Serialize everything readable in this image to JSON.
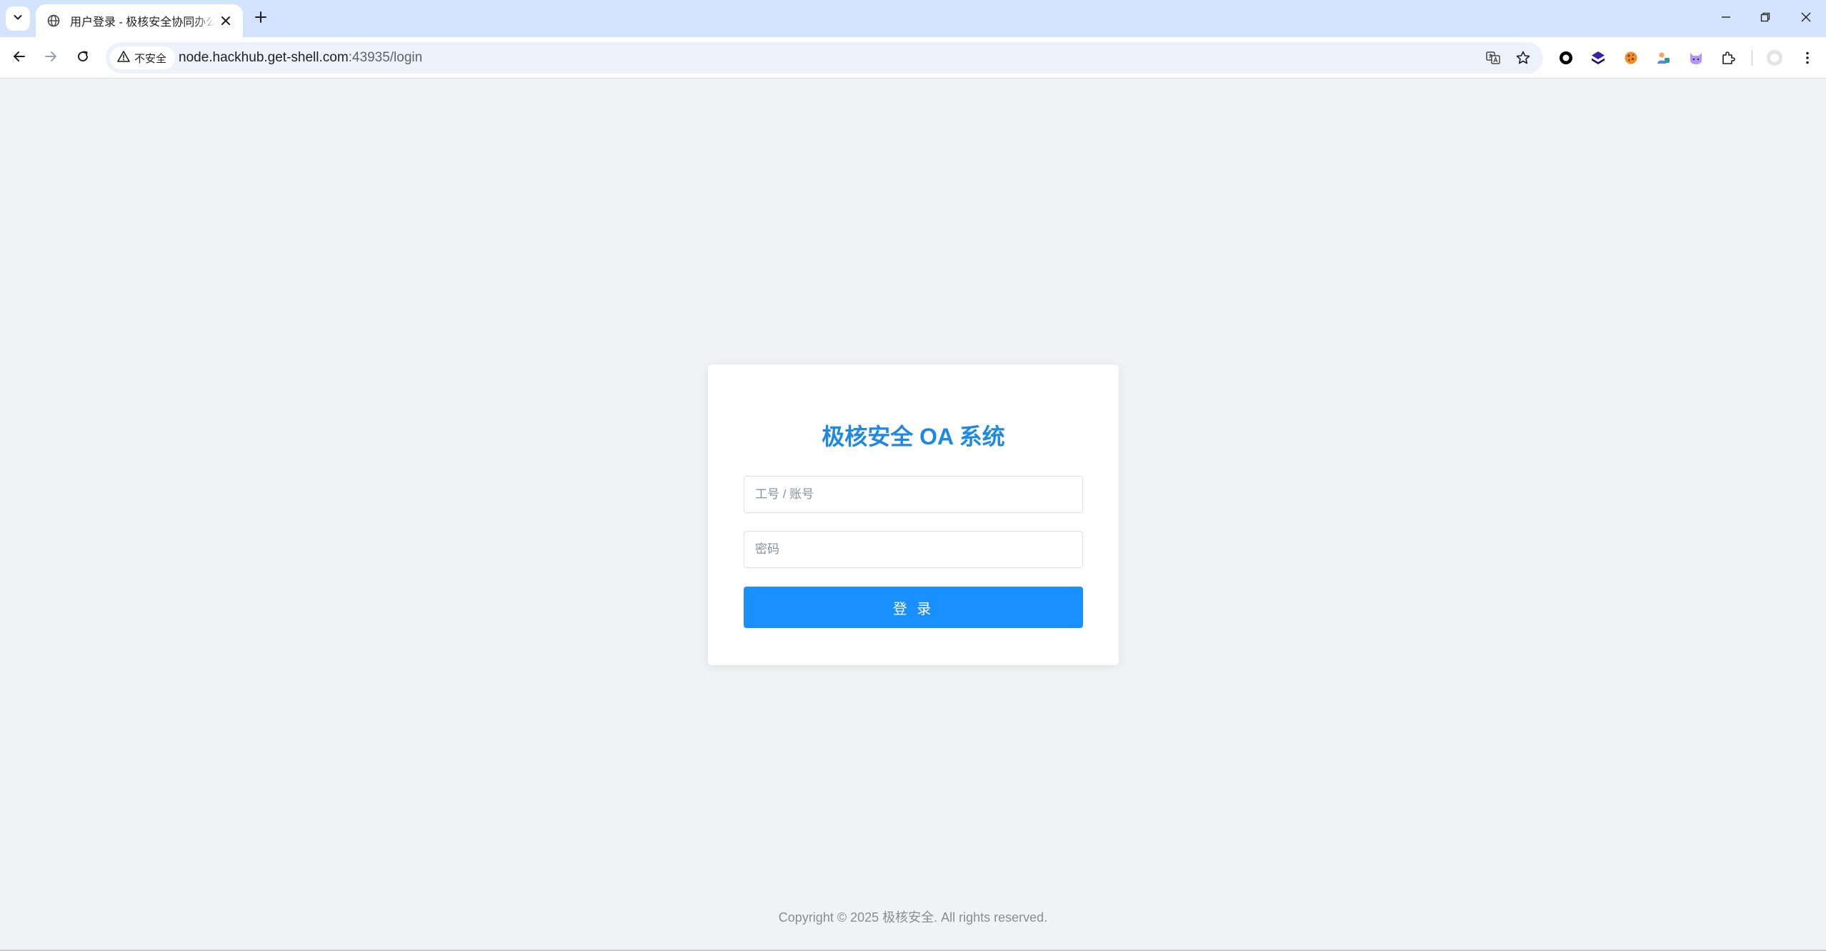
{
  "browser": {
    "tab": {
      "title": "用户登录 - 极核安全协同办公系统"
    },
    "address_bar": {
      "security_label": "不安全",
      "url_host": "node.hackhub.get-shell.com",
      "url_path": ":43935/login"
    },
    "extensions": [
      "circle-extension-icon",
      "layers-extension-icon",
      "cookie-extension-icon",
      "puzzle-person-extension-icon",
      "cat-extension-icon"
    ]
  },
  "login": {
    "title": "极核安全 OA 系统",
    "username_placeholder": "工号 / 账号",
    "username_value": "",
    "password_placeholder": "密码",
    "password_value": "",
    "submit_label": "登 录"
  },
  "footer": {
    "copyright": "Copyright © 2025 极核安全. All rights reserved."
  },
  "colors": {
    "accent": "#1890ff",
    "title": "#1e88e5",
    "page_bg": "#f0f2f5",
    "tabstrip_bg": "#d3e3fd"
  }
}
